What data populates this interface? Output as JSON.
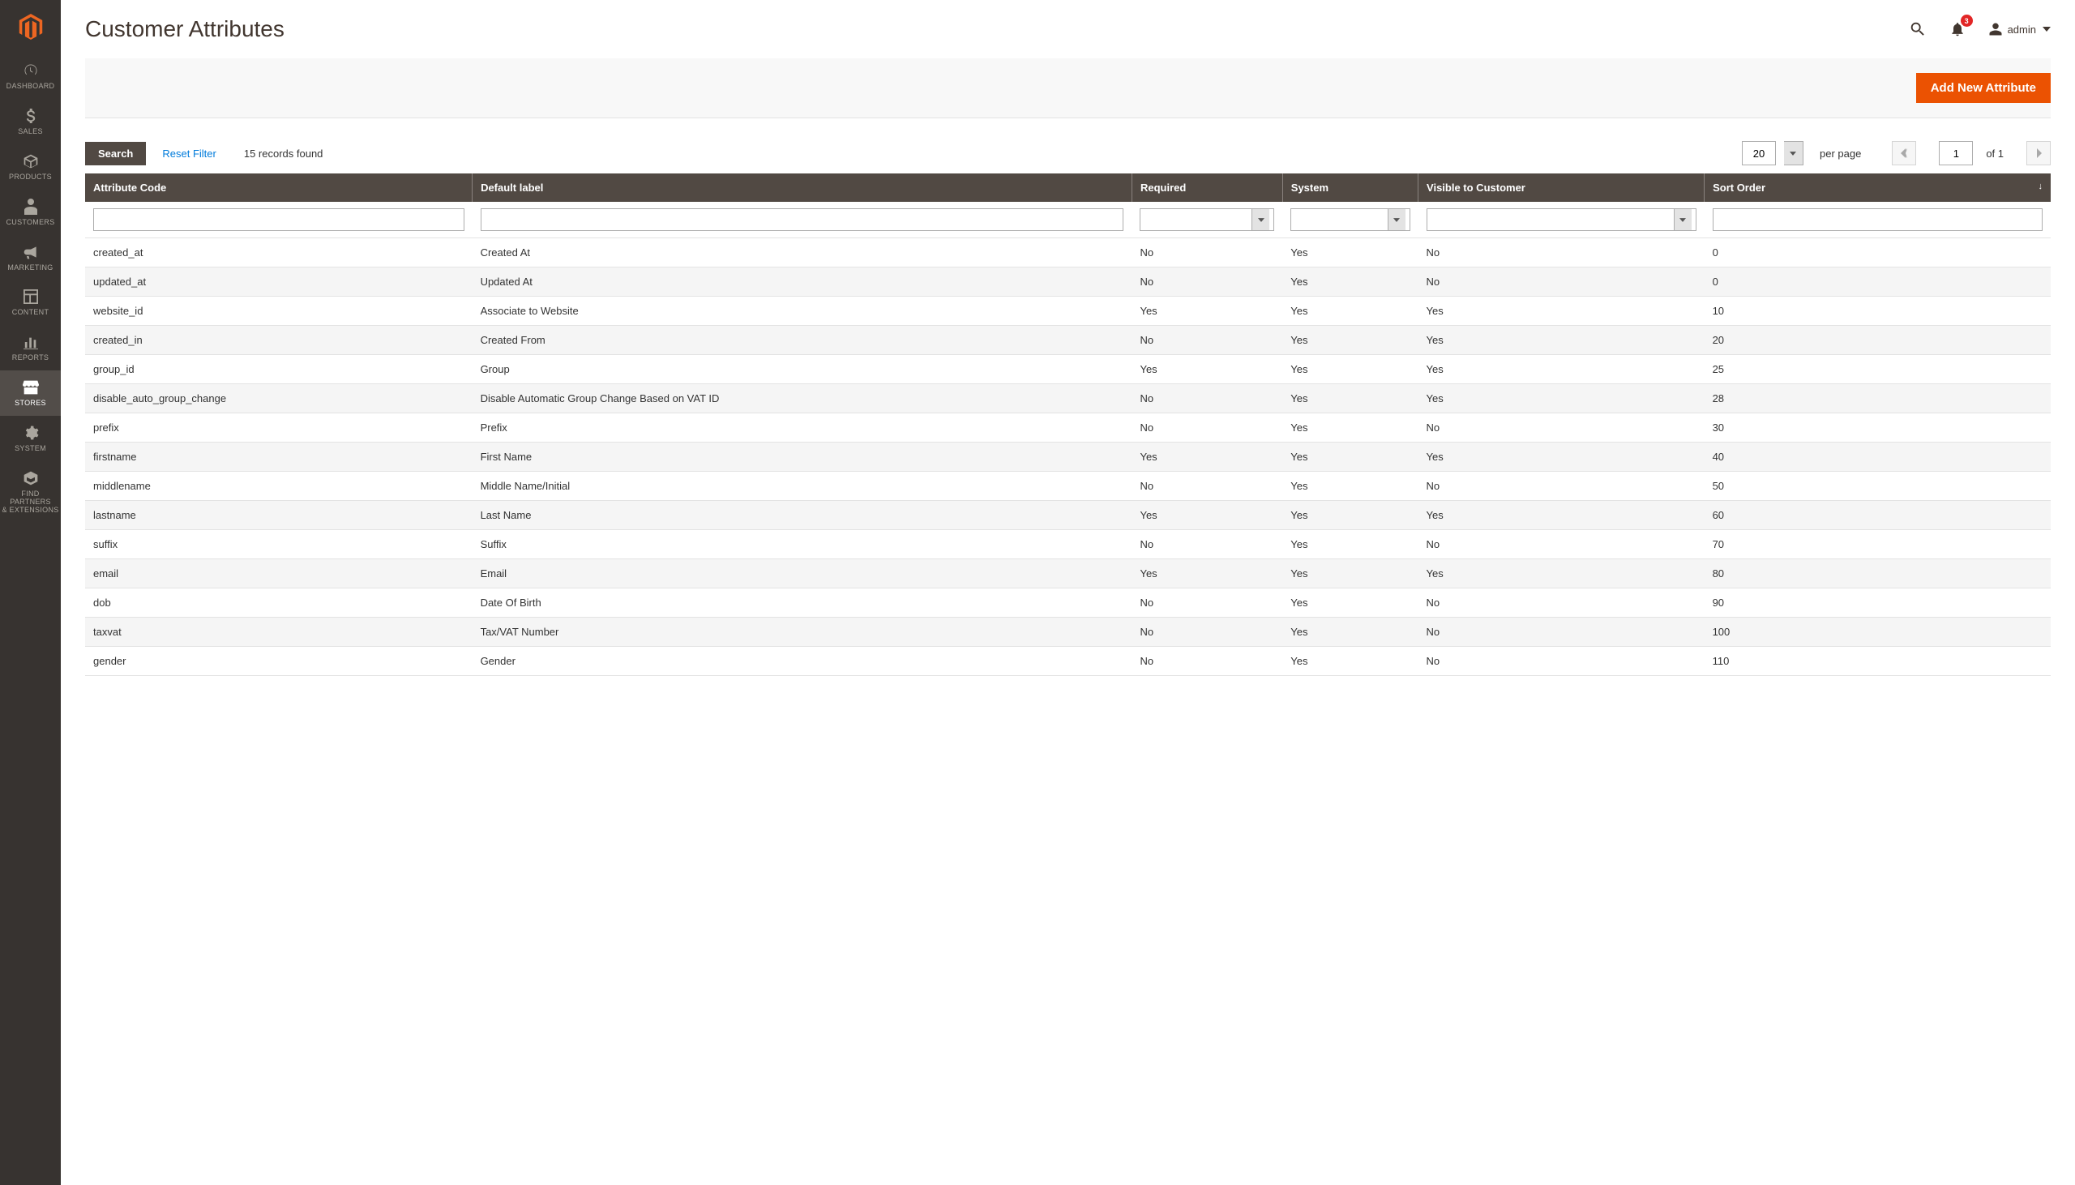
{
  "sidebar": {
    "items": [
      {
        "label": "DASHBOARD"
      },
      {
        "label": "SALES"
      },
      {
        "label": "PRODUCTS"
      },
      {
        "label": "CUSTOMERS"
      },
      {
        "label": "MARKETING"
      },
      {
        "label": "CONTENT"
      },
      {
        "label": "REPORTS"
      },
      {
        "label": "STORES"
      },
      {
        "label": "SYSTEM"
      },
      {
        "label_line1": "FIND PARTNERS",
        "label_line2": "& EXTENSIONS"
      }
    ]
  },
  "header": {
    "title": "Customer Attributes",
    "notification_count": "3",
    "username": "admin"
  },
  "actions": {
    "add_new": "Add New Attribute"
  },
  "controls": {
    "search": "Search",
    "reset": "Reset Filter",
    "records_found": "15 records found",
    "per_page_value": "20",
    "per_page_label": "per page",
    "current_page": "1",
    "of_pages": "of 1"
  },
  "columns": {
    "code": "Attribute Code",
    "label": "Default label",
    "required": "Required",
    "system": "System",
    "visible": "Visible to Customer",
    "sort": "Sort Order"
  },
  "rows": [
    {
      "code": "created_at",
      "label": "Created At",
      "required": "No",
      "system": "Yes",
      "visible": "No",
      "sort": "0"
    },
    {
      "code": "updated_at",
      "label": "Updated At",
      "required": "No",
      "system": "Yes",
      "visible": "No",
      "sort": "0"
    },
    {
      "code": "website_id",
      "label": "Associate to Website",
      "required": "Yes",
      "system": "Yes",
      "visible": "Yes",
      "sort": "10"
    },
    {
      "code": "created_in",
      "label": "Created From",
      "required": "No",
      "system": "Yes",
      "visible": "Yes",
      "sort": "20"
    },
    {
      "code": "group_id",
      "label": "Group",
      "required": "Yes",
      "system": "Yes",
      "visible": "Yes",
      "sort": "25"
    },
    {
      "code": "disable_auto_group_change",
      "label": "Disable Automatic Group Change Based on VAT ID",
      "required": "No",
      "system": "Yes",
      "visible": "Yes",
      "sort": "28"
    },
    {
      "code": "prefix",
      "label": "Prefix",
      "required": "No",
      "system": "Yes",
      "visible": "No",
      "sort": "30"
    },
    {
      "code": "firstname",
      "label": "First Name",
      "required": "Yes",
      "system": "Yes",
      "visible": "Yes",
      "sort": "40"
    },
    {
      "code": "middlename",
      "label": "Middle Name/Initial",
      "required": "No",
      "system": "Yes",
      "visible": "No",
      "sort": "50"
    },
    {
      "code": "lastname",
      "label": "Last Name",
      "required": "Yes",
      "system": "Yes",
      "visible": "Yes",
      "sort": "60"
    },
    {
      "code": "suffix",
      "label": "Suffix",
      "required": "No",
      "system": "Yes",
      "visible": "No",
      "sort": "70"
    },
    {
      "code": "email",
      "label": "Email",
      "required": "Yes",
      "system": "Yes",
      "visible": "Yes",
      "sort": "80"
    },
    {
      "code": "dob",
      "label": "Date Of Birth",
      "required": "No",
      "system": "Yes",
      "visible": "No",
      "sort": "90"
    },
    {
      "code": "taxvat",
      "label": "Tax/VAT Number",
      "required": "No",
      "system": "Yes",
      "visible": "No",
      "sort": "100"
    },
    {
      "code": "gender",
      "label": "Gender",
      "required": "No",
      "system": "Yes",
      "visible": "No",
      "sort": "110"
    }
  ]
}
